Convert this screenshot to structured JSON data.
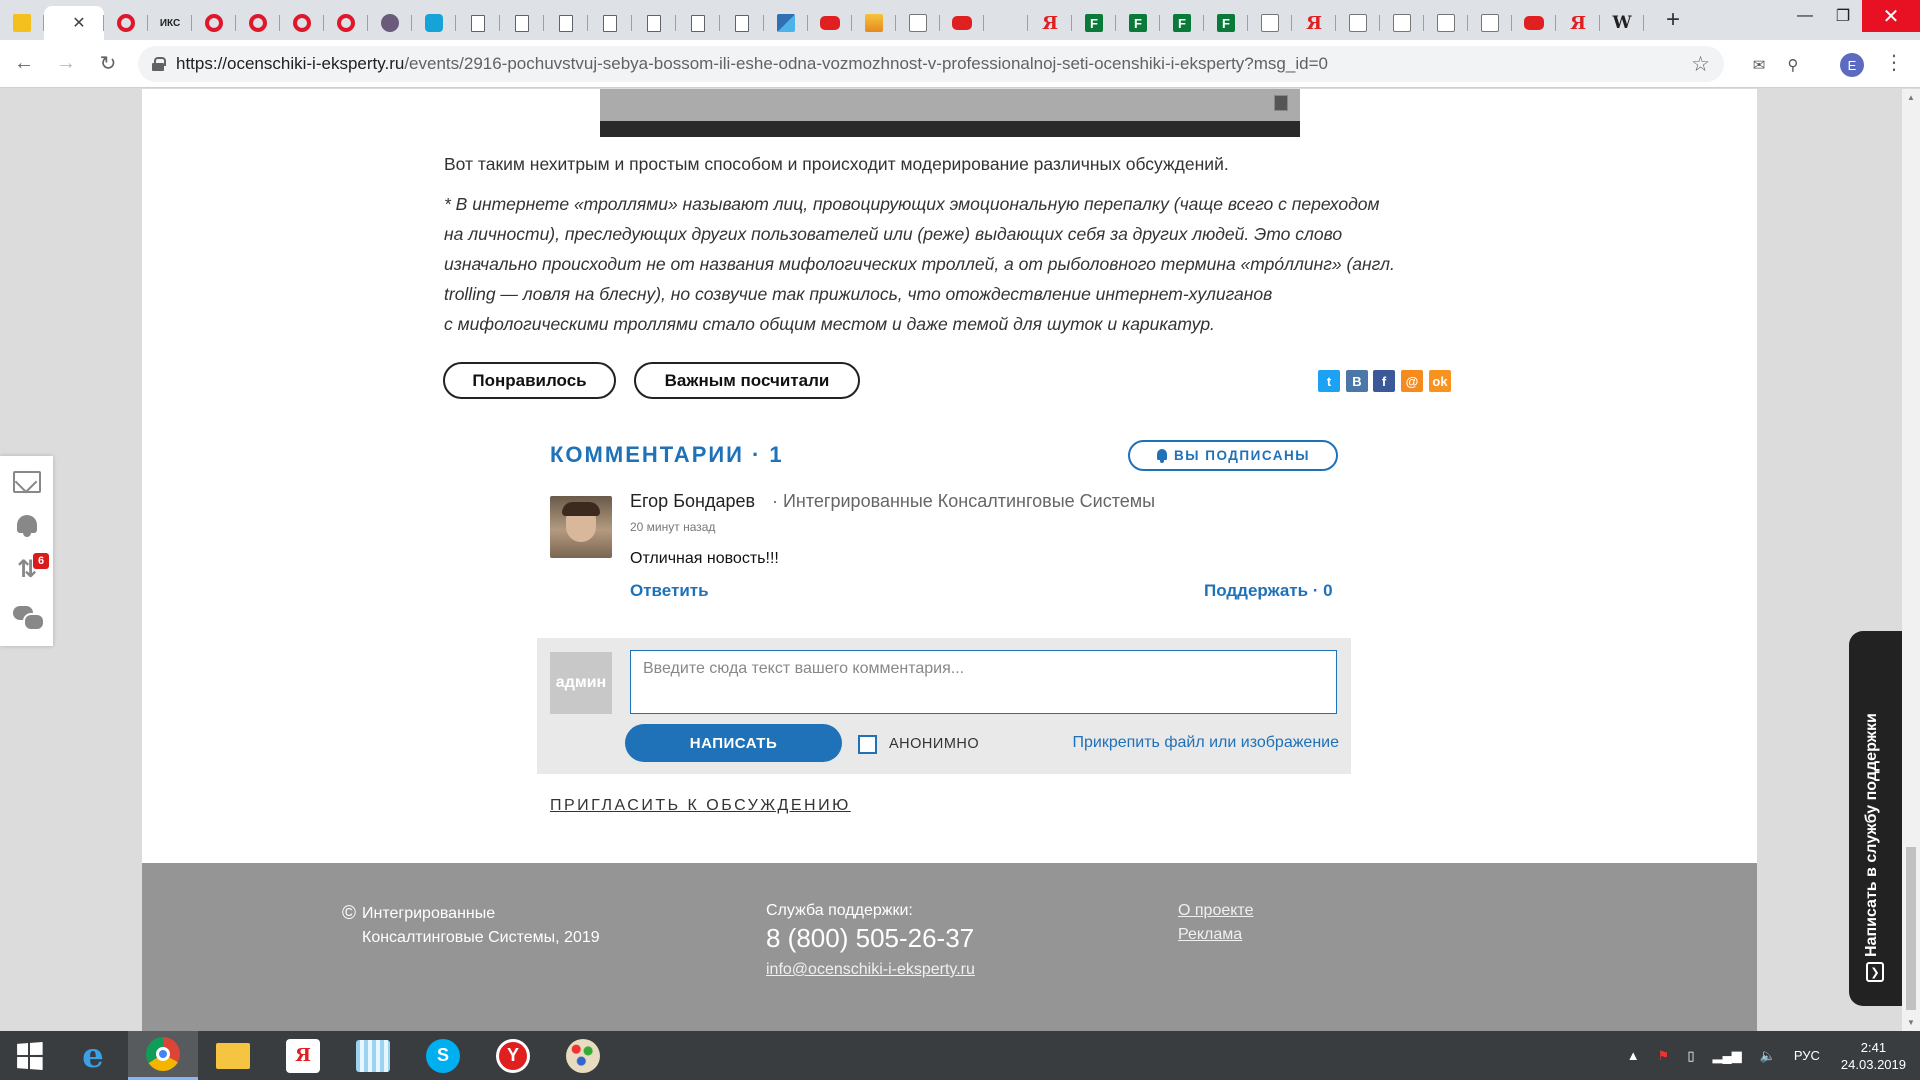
{
  "browser": {
    "tabs": [
      {
        "icon": "mail-icon",
        "label": ""
      },
      {
        "icon": "active-tab",
        "label": ""
      },
      {
        "icon": "opera-icon",
        "label": ""
      },
      {
        "icon": "iks-icon",
        "label": "ИКС"
      },
      {
        "icon": "opera-icon",
        "label": ""
      },
      {
        "icon": "opera-icon",
        "label": ""
      },
      {
        "icon": "opera-icon",
        "label": ""
      },
      {
        "icon": "opera-icon",
        "label": ""
      },
      {
        "icon": "avatar-favicon",
        "label": ""
      },
      {
        "icon": "bubble-icon",
        "label": ""
      },
      {
        "icon": "document-icon",
        "label": ""
      },
      {
        "icon": "document-icon",
        "label": ""
      },
      {
        "icon": "document-icon",
        "label": ""
      },
      {
        "icon": "document-icon",
        "label": ""
      },
      {
        "icon": "document-icon",
        "label": ""
      },
      {
        "icon": "document-icon",
        "label": ""
      },
      {
        "icon": "document-icon",
        "label": ""
      },
      {
        "icon": "grid-icon",
        "label": ""
      },
      {
        "icon": "youtube-icon",
        "label": ""
      },
      {
        "icon": "image-icon",
        "label": ""
      },
      {
        "icon": "chart-icon",
        "label": ""
      },
      {
        "icon": "youtube-icon",
        "label": ""
      },
      {
        "icon": "download-icon",
        "label": ""
      },
      {
        "icon": "yandex-icon",
        "label": "Я"
      },
      {
        "icon": "f-icon",
        "label": "F"
      },
      {
        "icon": "f-icon",
        "label": "F"
      },
      {
        "icon": "f-icon",
        "label": "F"
      },
      {
        "icon": "f-icon",
        "label": "F"
      },
      {
        "icon": "chart-icon",
        "label": ""
      },
      {
        "icon": "yandex-icon",
        "label": "Я"
      },
      {
        "icon": "chart-icon",
        "label": ""
      },
      {
        "icon": "chart-icon",
        "label": ""
      },
      {
        "icon": "chart-icon",
        "label": ""
      },
      {
        "icon": "chart-icon",
        "label": ""
      },
      {
        "icon": "youtube-icon",
        "label": ""
      },
      {
        "icon": "yandex-icon",
        "label": "Я"
      },
      {
        "icon": "wikipedia-icon",
        "label": "W"
      }
    ],
    "new_tab": "+",
    "url_host": "https://ocenschiki-i-eksperty.ru",
    "url_path": "/events/2916-pochuvstvuj-sebya-bossom-ili-eshe-odna-vozmozhnost-v-professionalnoj-seti-ocenshiki-i-eksperty?msg_id=0",
    "profile_initial": "E"
  },
  "article": {
    "lead": "Вот таким нехитрым и простым способом и происходит модерирование различных обсуждений.",
    "footnote_lines": [
      "* В интернете «троллями» называют лиц, провоцирующих эмоциональную перепалку (чаще всего с переходом",
      "на личности), преследующих других пользователей или (реже) выдающих себя за других людей. Это слово",
      "изначально происходит не от названия мифологических троллей, а от рыболовного термина «тро́ллинг» (англ.",
      "trolling — ловля на блесну), но созвучие так прижилось, что отождествление интернет-хулиганов",
      "с мифологическими троллями стало общим местом и даже темой для шуток и карикатур."
    ],
    "like_label": "Понравилось",
    "important_label": "Важным посчитали",
    "share": [
      {
        "name": "twitter-icon",
        "glyph": "t",
        "color": "#1da1f2"
      },
      {
        "name": "vk-icon",
        "glyph": "B",
        "color": "#4a76a8"
      },
      {
        "name": "facebook-icon",
        "glyph": "f",
        "color": "#3b5998"
      },
      {
        "name": "mailru-icon",
        "glyph": "@",
        "color": "#f58a1f"
      },
      {
        "name": "odnoklassniki-icon",
        "glyph": "ok",
        "color": "#f7931e"
      }
    ]
  },
  "comments": {
    "title": "КОММЕНТАРИИ",
    "dot": "·",
    "count": "1",
    "subscribed_label": "ВЫ ПОДПИСАНЫ",
    "items": [
      {
        "author": "Егор Бондарев",
        "company": "· Интегрированные Консалтинговые Системы",
        "time": "20 минут назад",
        "text": "Отличная новость!!!",
        "reply_label": "Ответить",
        "support_label": "Поддержать · 0"
      }
    ],
    "form": {
      "avatar_label": "админ",
      "placeholder": "Введите сюда текст вашего комментария...",
      "send_label": "НАПИСАТЬ",
      "anonymous_label": "АНОНИМНО",
      "attach_label": "Прикрепить файл или изображение"
    },
    "invite_label": "ПРИГЛАСИТЬ К ОБСУЖДЕНИЮ"
  },
  "footer": {
    "copyright_symbol": "©",
    "company_line1": "Интегрированные",
    "company_line2": "Консалтинговые Системы, 2019",
    "support_label": "Служба поддержки:",
    "phone": "8 (800) 505-26-37",
    "email": "info@ocenschiki-i-eksperty.ru",
    "links": [
      "О проекте",
      "Реклама"
    ]
  },
  "side_panel": {
    "badge_count": "6"
  },
  "support_tab": {
    "label": "Написать в службу поддержки"
  },
  "taskbar": {
    "language": "РУС",
    "time": "2:41",
    "date": "24.03.2019"
  }
}
